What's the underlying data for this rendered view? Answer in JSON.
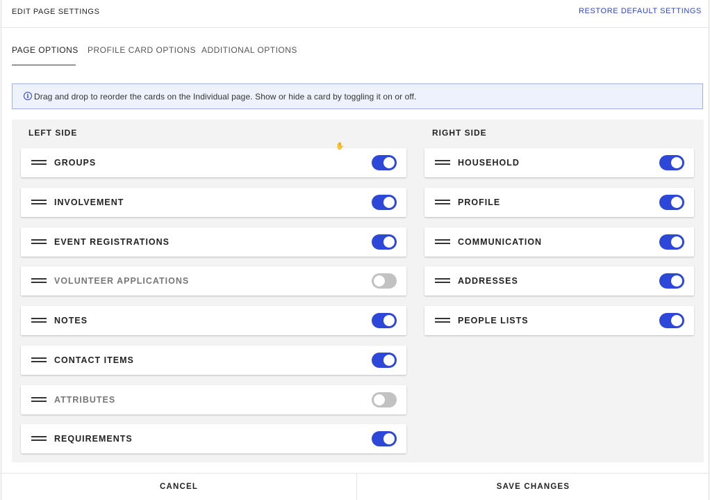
{
  "header": {
    "title": "EDIT PAGE SETTINGS",
    "restore_label": "RESTORE DEFAULT SETTINGS"
  },
  "tabs": [
    {
      "label": "PAGE OPTIONS",
      "active": true
    },
    {
      "label": "PROFILE CARD OPTIONS",
      "active": false
    },
    {
      "label": "ADDITIONAL OPTIONS",
      "active": false
    }
  ],
  "info": {
    "icon": "info-icon",
    "text": "Drag and drop to reorder the cards on the Individual page. Show or hide a card by toggling it on or off."
  },
  "left": {
    "title": "LEFT SIDE",
    "cards": [
      {
        "label": "GROUPS",
        "enabled": true
      },
      {
        "label": "INVOLVEMENT",
        "enabled": true
      },
      {
        "label": "EVENT REGISTRATIONS",
        "enabled": true
      },
      {
        "label": "VOLUNTEER APPLICATIONS",
        "enabled": false
      },
      {
        "label": "NOTES",
        "enabled": true
      },
      {
        "label": "CONTACT ITEMS",
        "enabled": true
      },
      {
        "label": "ATTRIBUTES",
        "enabled": false
      },
      {
        "label": "REQUIREMENTS",
        "enabled": true
      }
    ]
  },
  "right": {
    "title": "RIGHT SIDE",
    "cards": [
      {
        "label": "HOUSEHOLD",
        "enabled": true
      },
      {
        "label": "PROFILE",
        "enabled": true
      },
      {
        "label": "COMMUNICATION",
        "enabled": true
      },
      {
        "label": "ADDRESSES",
        "enabled": true
      },
      {
        "label": "PEOPLE LISTS",
        "enabled": true
      }
    ]
  },
  "footer": {
    "cancel_label": "CANCEL",
    "save_label": "SAVE CHANGES"
  },
  "colors": {
    "accent": "#2d48d8",
    "link": "#2b45d4",
    "toggle_off": "#c2c2c2",
    "panel_bg": "#f3f3f3",
    "banner_bg": "#eef2fc"
  }
}
